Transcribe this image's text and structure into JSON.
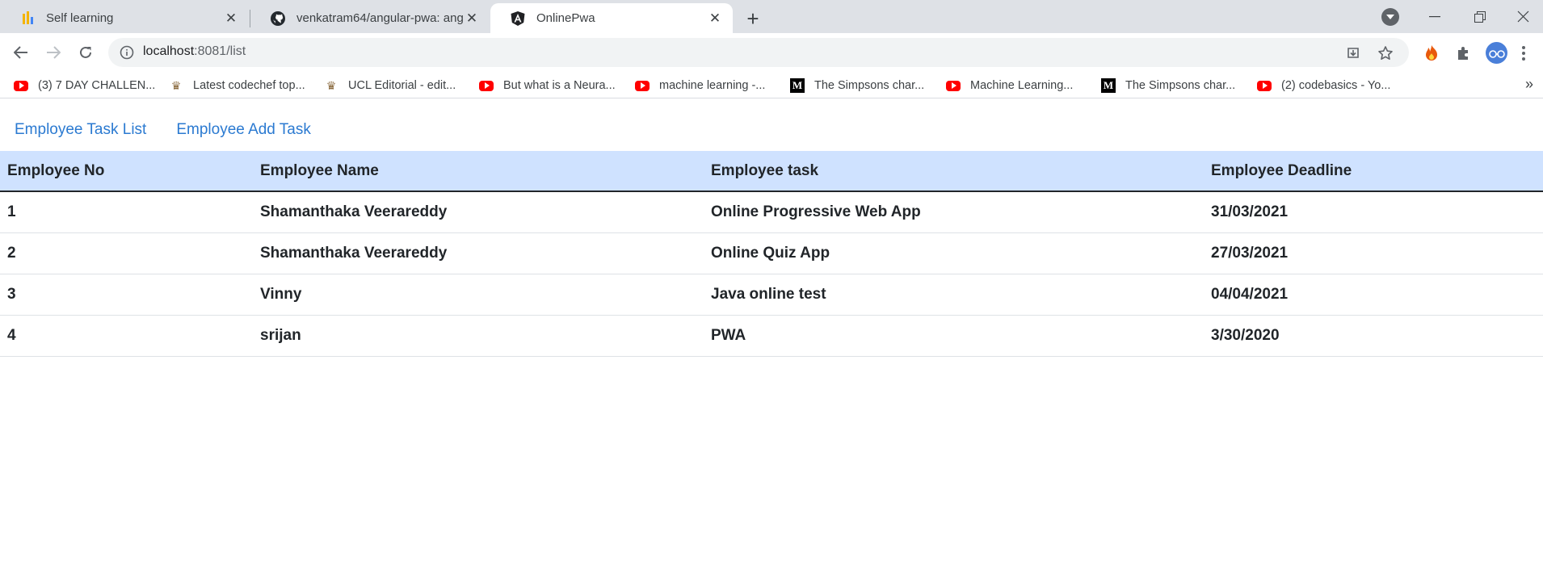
{
  "browser": {
    "tabs": [
      {
        "title": "Self learning",
        "favicon": "bar-chart-icon"
      },
      {
        "title": "venkatram64/angular-pwa: angu",
        "favicon": "github-icon"
      },
      {
        "title": "OnlinePwa",
        "favicon": "angular-icon",
        "active": true
      }
    ],
    "url_host": "localhost",
    "url_path": ":8081/list"
  },
  "bookmarks": [
    {
      "label": "(3) 7 DAY CHALLEN...",
      "icon": "youtube-icon"
    },
    {
      "label": "Latest codechef top...",
      "icon": "codechef-icon"
    },
    {
      "label": "UCL Editorial - edit...",
      "icon": "codechef-icon"
    },
    {
      "label": "But what is a Neura...",
      "icon": "youtube-icon"
    },
    {
      "label": "machine learning -...",
      "icon": "youtube-icon"
    },
    {
      "label": "The Simpsons char...",
      "icon": "medium-icon"
    },
    {
      "label": "Machine Learning...",
      "icon": "youtube-icon"
    },
    {
      "label": "The Simpsons char...",
      "icon": "medium-icon"
    },
    {
      "label": "(2) codebasics - Yo...",
      "icon": "youtube-icon"
    }
  ],
  "nav": {
    "list_link": "Employee Task List",
    "add_link": "Employee Add Task"
  },
  "table": {
    "headers": [
      "Employee No",
      "Employee Name",
      "Employee task",
      "Employee Deadline"
    ],
    "rows": [
      [
        "1",
        "Shamanthaka Veerareddy",
        "Online Progressive Web App",
        "31/03/2021"
      ],
      [
        "2",
        "Shamanthaka Veerareddy",
        "Online Quiz App",
        "27/03/2021"
      ],
      [
        "3",
        "Vinny",
        "Java online test",
        "04/04/2021"
      ],
      [
        "4",
        "srijan",
        "PWA",
        "3/30/2020"
      ]
    ]
  },
  "colors": {
    "header_bg": "#cfe2ff",
    "link": "#2b7ad1",
    "tabstrip_bg": "#dee1e6"
  }
}
